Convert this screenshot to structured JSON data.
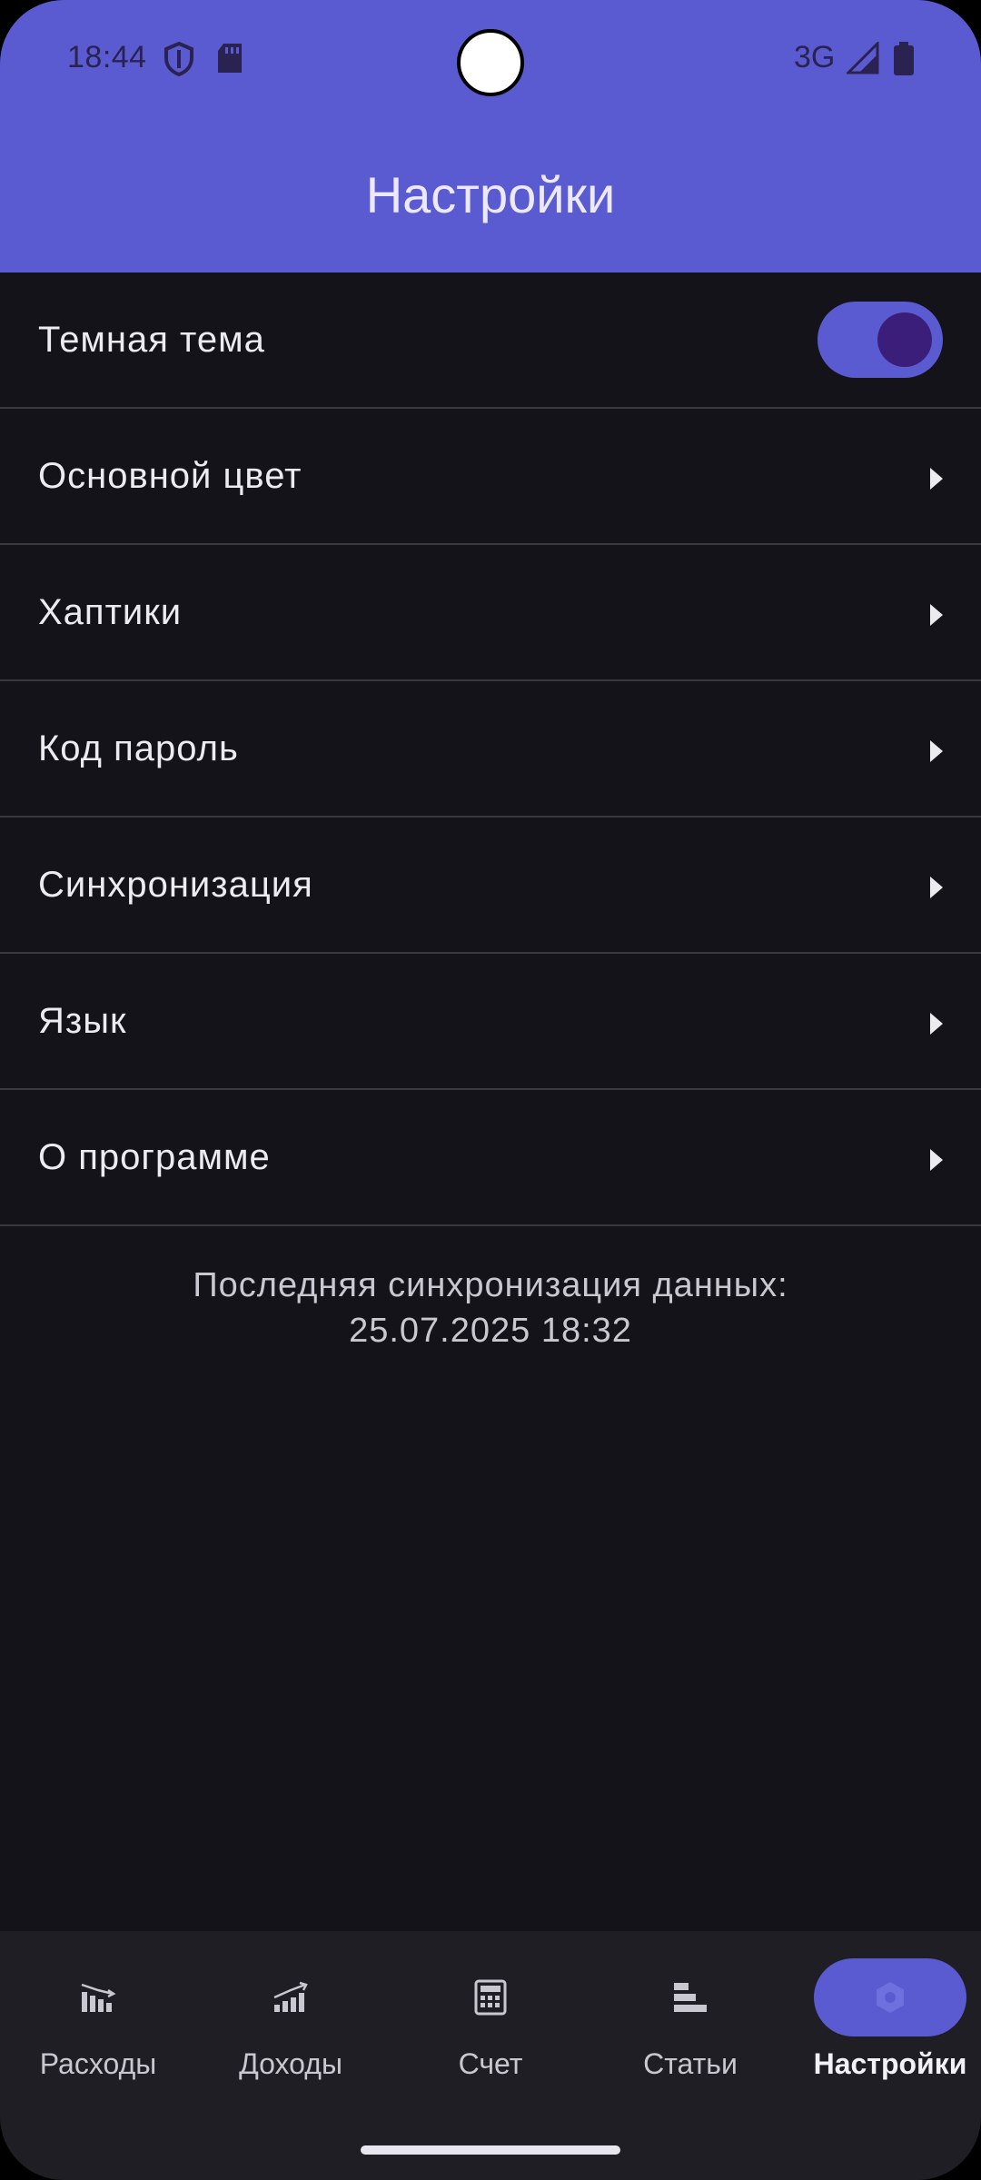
{
  "status_bar": {
    "time": "18:44",
    "network": "3G",
    "icons": [
      "shield-icon",
      "sd-card-icon",
      "signal-icon",
      "battery-icon"
    ]
  },
  "header": {
    "title": "Настройки"
  },
  "settings": {
    "dark_theme": {
      "label": "Темная тема",
      "enabled": true
    },
    "items": [
      {
        "label": "Основной цвет"
      },
      {
        "label": "Хаптики"
      },
      {
        "label": "Код пароль"
      },
      {
        "label": "Синхронизация"
      },
      {
        "label": "Язык"
      },
      {
        "label": "О программе"
      }
    ]
  },
  "sync_info": {
    "line1": "Последняя синхронизация данных:",
    "line2": "25.07.2025 18:32"
  },
  "bottom_nav": {
    "items": [
      {
        "label": "Расходы",
        "icon": "expenses-chart-icon"
      },
      {
        "label": "Доходы",
        "icon": "income-chart-icon"
      },
      {
        "label": "Счет",
        "icon": "calculator-icon"
      },
      {
        "label": "Статьи",
        "icon": "articles-icon"
      },
      {
        "label": "Настройки",
        "icon": "settings-icon",
        "active": true
      }
    ]
  },
  "colors": {
    "accent": "#5a5bd0",
    "background": "#15131a",
    "nav_background": "#1f1e25",
    "toggle_knob": "#3a1e7a"
  }
}
